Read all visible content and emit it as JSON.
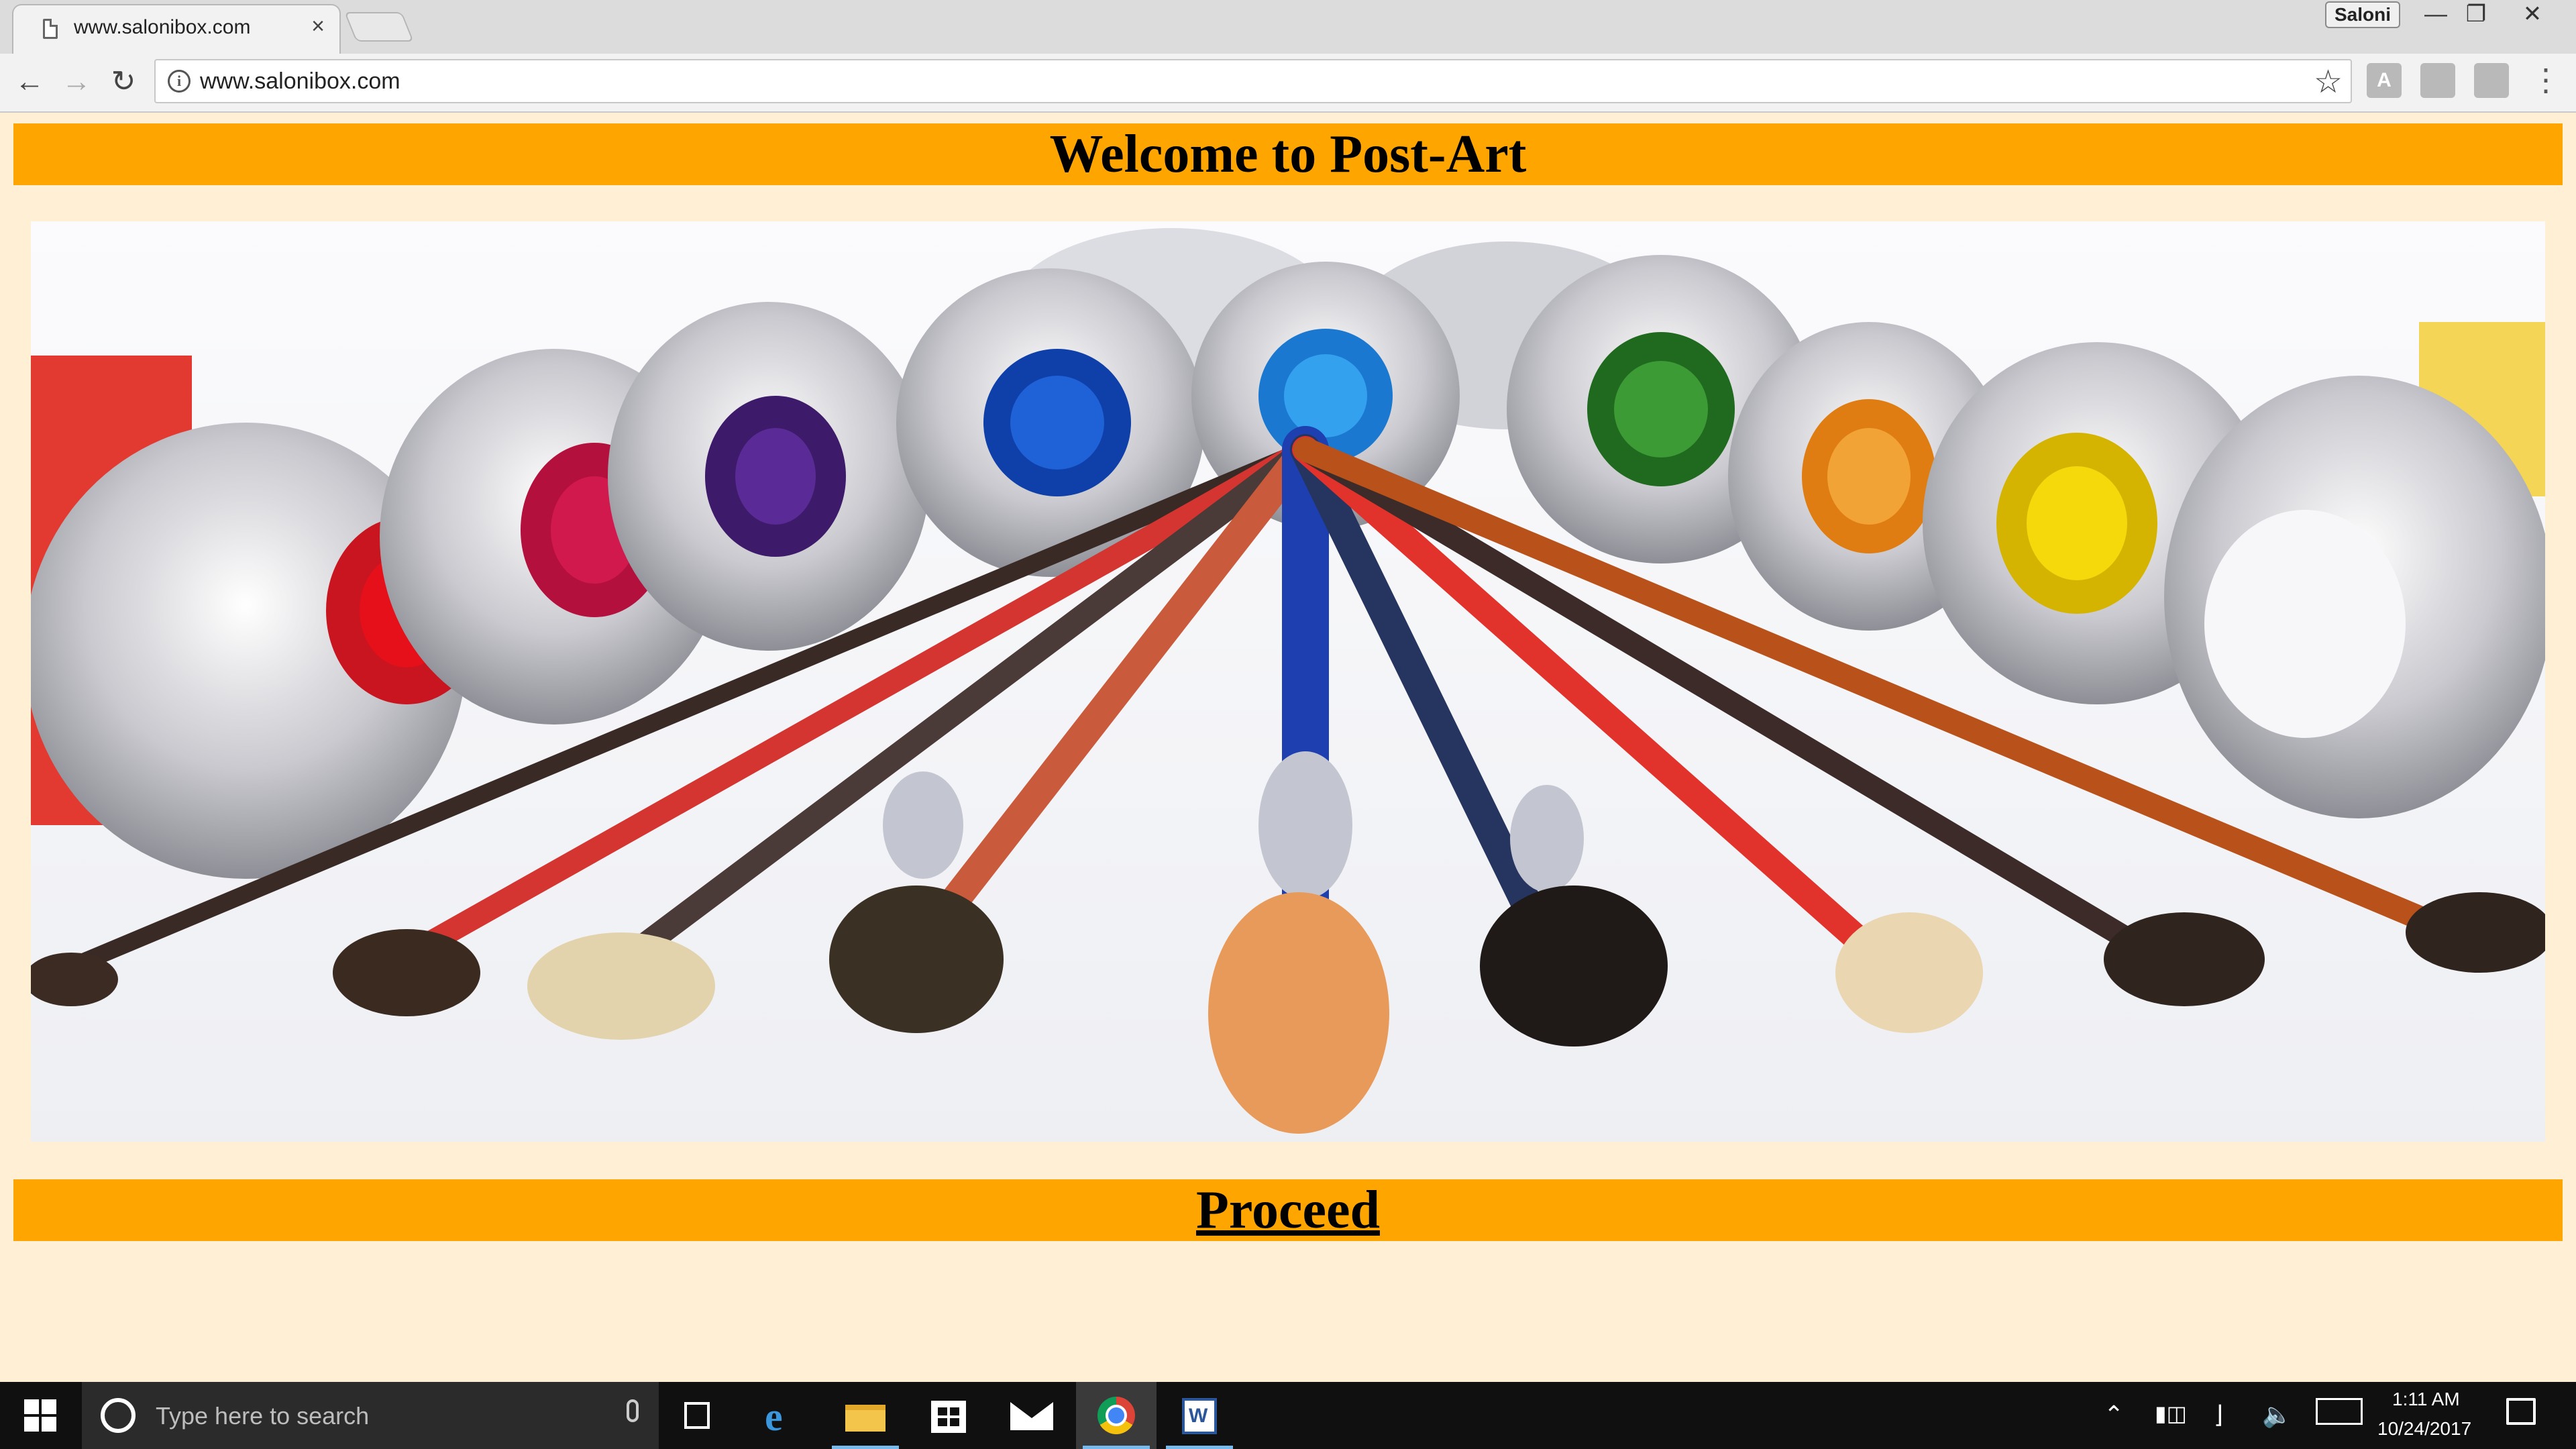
{
  "browser": {
    "tab_title": "www.salonibox.com",
    "tab_close": "×",
    "profile_name": "Saloni",
    "url": "www.salonibox.com",
    "ext_1": "A"
  },
  "page": {
    "heading": "Welcome to Post-Art",
    "proceed_link": "Proceed",
    "accent_color": "#ffa500",
    "background_color": "#ffefd5"
  },
  "taskbar": {
    "search_placeholder": "Type here to search",
    "time": "1:11 AM",
    "date": "10/24/2017"
  }
}
